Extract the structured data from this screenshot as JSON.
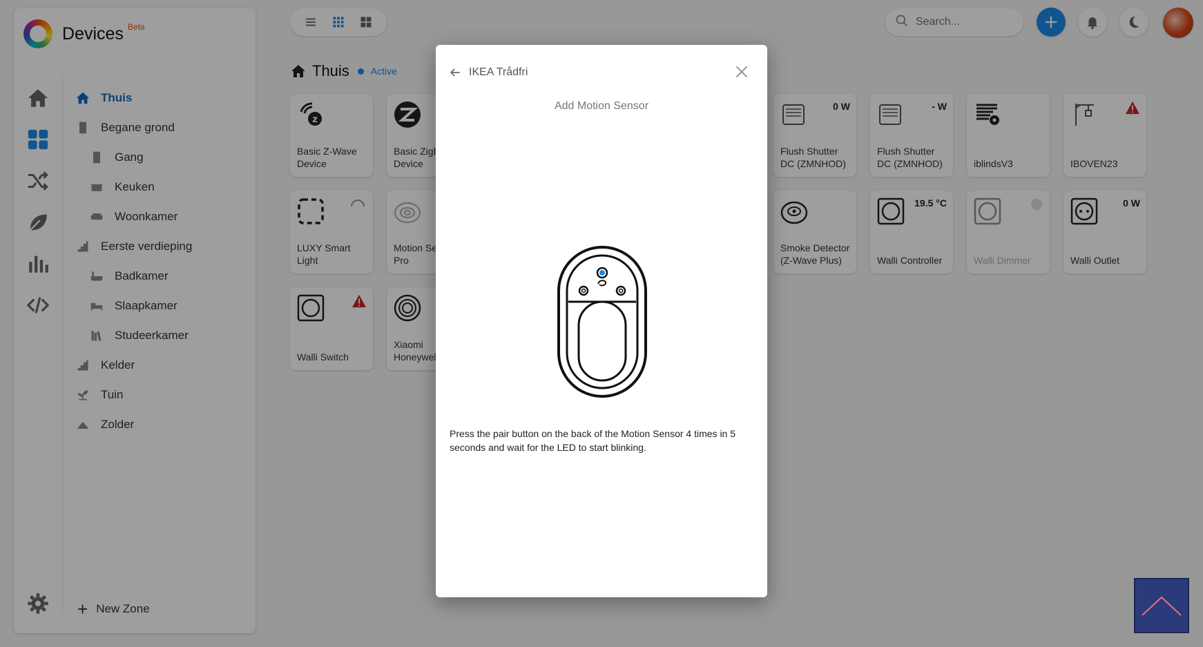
{
  "app": {
    "title": "Devices",
    "badge": "Beta"
  },
  "colors": {
    "accent": "#1e88e5",
    "alert": "#c62828",
    "beta": "#e65100"
  },
  "rail": {
    "items": [
      {
        "icon": "home-icon"
      },
      {
        "icon": "devices-grid-icon",
        "active": true
      },
      {
        "icon": "flows-shuffle-icon"
      },
      {
        "icon": "energy-leaf-icon"
      },
      {
        "icon": "insights-chart-icon"
      },
      {
        "icon": "code-icon"
      }
    ],
    "settings_icon": "gear-icon"
  },
  "zones": [
    {
      "label": "Thuis",
      "level": 0,
      "active": true,
      "icon": "home-icon"
    },
    {
      "label": "Begane grond",
      "level": 0,
      "icon": "door-icon"
    },
    {
      "label": "Gang",
      "level": 1,
      "icon": "door-icon"
    },
    {
      "label": "Keuken",
      "level": 1,
      "icon": "pot-icon"
    },
    {
      "label": "Woonkamer",
      "level": 1,
      "icon": "sofa-icon"
    },
    {
      "label": "Eerste verdieping",
      "level": 0,
      "icon": "stairs-icon"
    },
    {
      "label": "Badkamer",
      "level": 1,
      "icon": "bath-icon"
    },
    {
      "label": "Slaapkamer",
      "level": 1,
      "icon": "bed-icon"
    },
    {
      "label": "Studeerkamer",
      "level": 1,
      "icon": "books-icon"
    },
    {
      "label": "Kelder",
      "level": 0,
      "icon": "stairs-icon"
    },
    {
      "label": "Tuin",
      "level": 0,
      "icon": "plant-icon"
    },
    {
      "label": "Zolder",
      "level": 0,
      "icon": "attic-icon"
    }
  ],
  "new_zone_label": "New Zone",
  "search": {
    "placeholder": "Search..."
  },
  "zone_header": {
    "name": "Thuis",
    "status": "Active"
  },
  "devices": [
    {
      "name": "Basic Z-Wave Device",
      "icon": "zwave-icon",
      "value": ""
    },
    {
      "name": "Basic Zigbee Device",
      "icon": "zigbee-icon",
      "value": ""
    },
    {
      "name": "Flush Shutter DC (ZMNHOD)",
      "icon": "shutter-icon",
      "value": "0 W"
    },
    {
      "name": "Flush Shutter DC (ZMNHOD)",
      "icon": "shutter-icon",
      "value": "- W"
    },
    {
      "name": "iblindsV3",
      "icon": "blinds-gear-icon",
      "value": ""
    },
    {
      "name": "IBOVEN23",
      "icon": "crane-icon",
      "value": "",
      "alert": true
    },
    {
      "name": "LUXY Smart Light",
      "icon": "dashed-square-icon",
      "value": "",
      "loading": true
    },
    {
      "name": "Motion Sensor Pro",
      "icon": "motion-sensor-icon",
      "value": ""
    },
    {
      "name": "Smoke Detector (Z-Wave Plus)",
      "icon": "smoke-detector-icon",
      "value": ""
    },
    {
      "name": "Walli Controller",
      "icon": "wall-switch-icon",
      "value": "19.5 °C"
    },
    {
      "name": "Walli Dimmer",
      "icon": "wall-switch-icon",
      "value": "",
      "dim": true
    },
    {
      "name": "Walli Outlet",
      "icon": "wall-outlet-icon",
      "value": "0 W"
    },
    {
      "name": "Walli Switch",
      "icon": "wall-switch-icon",
      "value": "",
      "alert": true
    },
    {
      "name": "Xiaomi Honeywell",
      "icon": "round-detector-icon",
      "value": ""
    }
  ],
  "modal": {
    "back_label": "IKEA Trådfri",
    "subtitle": "Add Motion Sensor",
    "instructions": "Press the pair button on the back of the Motion Sensor 4 times in 5 seconds and wait for the LED to start blinking."
  }
}
